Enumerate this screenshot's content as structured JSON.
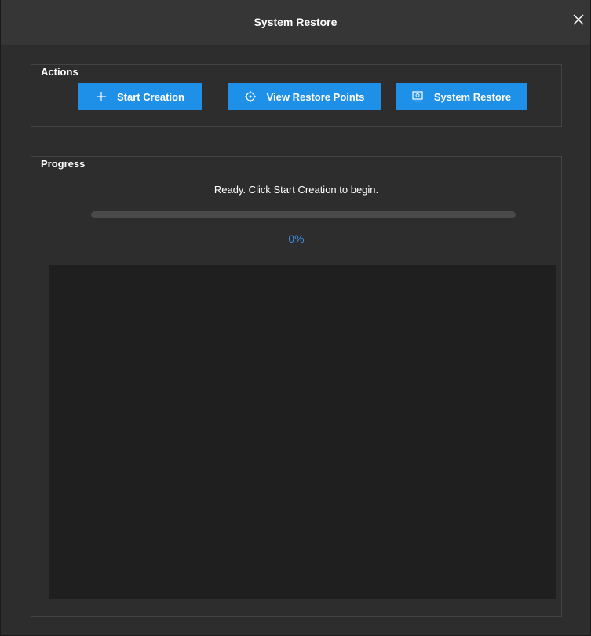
{
  "window": {
    "title": "System Restore"
  },
  "icons": {
    "close": "close-icon",
    "start": "plus-icon",
    "view": "target-icon",
    "restore": "monitor-icon"
  },
  "actions": {
    "legend": "Actions",
    "start_label": "Start Creation",
    "view_label": "View Restore Points",
    "restore_label": "System Restore"
  },
  "progress": {
    "legend": "Progress",
    "status": "Ready. Click Start Creation to begin.",
    "percent_label": "0%",
    "percent": 0,
    "log": ""
  },
  "colors": {
    "accent": "#1e90e8",
    "percent_text": "#3b8fe6",
    "background": "#2d2d2d",
    "log_background": "#1f1f1f"
  }
}
